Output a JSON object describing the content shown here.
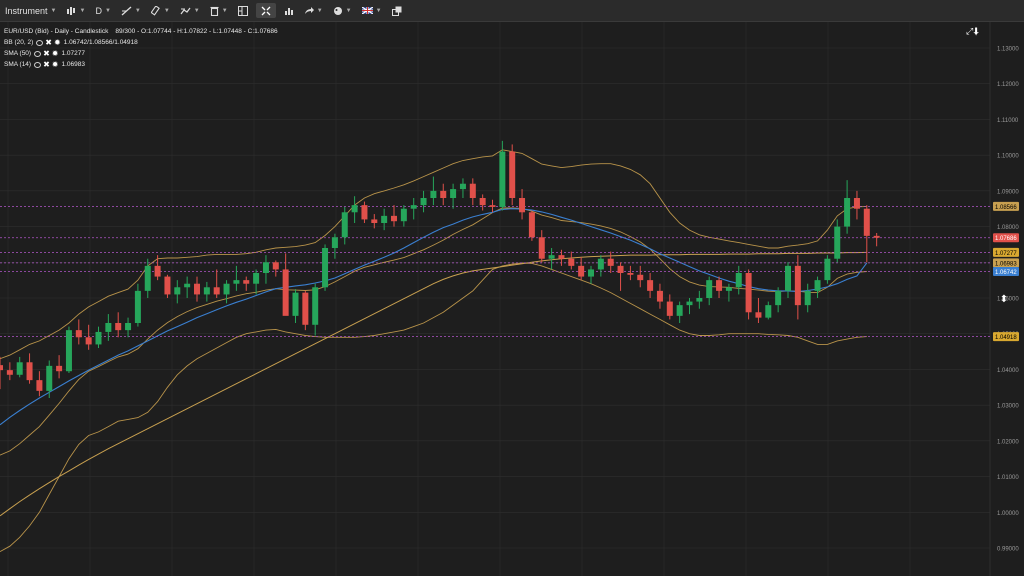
{
  "toolbar": {
    "instrument_label": "Instrument",
    "timeframe_label": "D",
    "icons": [
      "chart-type-icon",
      "draw-line-icon",
      "ruler-icon",
      "indicators-icon",
      "delete-icon",
      "layout-icon",
      "fit-icon",
      "bar-chart-icon",
      "share-icon",
      "theme-icon",
      "language-flag-icon",
      "popout-icon"
    ]
  },
  "legend": {
    "title": "EUR/USD (Bid) - Daily - Candlestick",
    "ohlc": "89/300 - O:1.07744 - H:1.07822 - L:1.07448 - C:1.07686",
    "indicators": [
      {
        "name": "BB (20, 2)",
        "value": "1.06742/1.08566/1.04918"
      },
      {
        "name": "SMA (50)",
        "value": "1.07277"
      },
      {
        "name": "SMA (14)",
        "value": "1.06983"
      }
    ]
  },
  "colors": {
    "bg": "#1e1e1e",
    "grid": "#2e2e2e",
    "up": "#26a65b",
    "down": "#e0504a",
    "bb": "#b8934a",
    "sma50": "#c8a050",
    "sma14": "#3a7fd0",
    "level_line": "#b056c8"
  },
  "chart_data": {
    "type": "candlestick",
    "instrument": "EUR/USD (Bid)",
    "timeframe": "Daily",
    "ylim": [
      0.99,
      1.135
    ],
    "y_ticks": [
      "1.13000",
      "1.12000",
      "1.11000",
      "1.10000",
      "1.09000",
      "1.08000",
      "1.07000",
      "1.06000",
      "1.05000",
      "1.04000",
      "1.03000",
      "1.02000",
      "1.01000",
      "1.00000",
      "0.99000"
    ],
    "candles": [
      [
        1.0412,
        1.0435,
        1.0345,
        1.0398
      ],
      [
        1.0398,
        1.042,
        1.037,
        1.0385
      ],
      [
        1.0385,
        1.0435,
        1.0378,
        1.042
      ],
      [
        1.042,
        1.0445,
        1.036,
        1.037
      ],
      [
        1.037,
        1.0395,
        1.0325,
        1.034
      ],
      [
        1.034,
        1.0425,
        1.032,
        1.041
      ],
      [
        1.041,
        1.044,
        1.0375,
        1.0395
      ],
      [
        1.0395,
        1.052,
        1.039,
        1.051
      ],
      [
        1.051,
        1.054,
        1.047,
        1.049
      ],
      [
        1.049,
        1.0525,
        1.0455,
        1.047
      ],
      [
        1.047,
        1.052,
        1.046,
        1.0505
      ],
      [
        1.0505,
        1.0555,
        1.048,
        1.053
      ],
      [
        1.053,
        1.056,
        1.049,
        1.051
      ],
      [
        1.051,
        1.0545,
        1.049,
        1.053
      ],
      [
        1.053,
        1.064,
        1.052,
        1.062
      ],
      [
        1.062,
        1.071,
        1.06,
        1.069
      ],
      [
        1.069,
        1.072,
        1.065,
        1.066
      ],
      [
        1.066,
        1.0665,
        1.06,
        1.061
      ],
      [
        1.061,
        1.065,
        1.0585,
        1.063
      ],
      [
        1.063,
        1.066,
        1.06,
        1.064
      ],
      [
        1.064,
        1.066,
        1.059,
        1.061
      ],
      [
        1.061,
        1.0645,
        1.059,
        1.063
      ],
      [
        1.063,
        1.068,
        1.06,
        1.061
      ],
      [
        1.061,
        1.065,
        1.0585,
        1.064
      ],
      [
        1.064,
        1.069,
        1.062,
        1.065
      ],
      [
        1.065,
        1.066,
        1.062,
        1.064
      ],
      [
        1.064,
        1.068,
        1.061,
        1.067
      ],
      [
        1.067,
        1.072,
        1.064,
        1.07
      ],
      [
        1.07,
        1.0705,
        1.066,
        1.068
      ],
      [
        1.068,
        1.0725,
        1.06,
        1.055
      ],
      [
        1.055,
        1.0625,
        1.053,
        1.0615
      ],
      [
        1.0615,
        1.062,
        1.051,
        1.0525
      ],
      [
        1.0525,
        1.064,
        1.0495,
        1.063
      ],
      [
        1.063,
        1.075,
        1.062,
        1.074
      ],
      [
        1.074,
        1.078,
        1.071,
        1.077
      ],
      [
        1.077,
        1.0855,
        1.075,
        1.084
      ],
      [
        1.084,
        1.0885,
        1.081,
        1.086
      ],
      [
        1.086,
        1.087,
        1.081,
        1.082
      ],
      [
        1.082,
        1.0835,
        1.0795,
        1.081
      ],
      [
        1.081,
        1.085,
        1.079,
        1.083
      ],
      [
        1.083,
        1.086,
        1.08,
        1.0815
      ],
      [
        1.0815,
        1.086,
        1.08,
        1.085
      ],
      [
        1.085,
        1.088,
        1.082,
        1.086
      ],
      [
        1.086,
        1.09,
        1.084,
        1.088
      ],
      [
        1.088,
        1.094,
        1.086,
        1.09
      ],
      [
        1.09,
        1.092,
        1.086,
        1.088
      ],
      [
        1.088,
        1.092,
        1.085,
        1.0905
      ],
      [
        1.0905,
        1.0935,
        1.088,
        1.092
      ],
      [
        1.092,
        1.0935,
        1.086,
        1.088
      ],
      [
        1.088,
        1.089,
        1.0845,
        1.086
      ],
      [
        1.086,
        1.0875,
        1.084,
        1.0855
      ],
      [
        1.0855,
        1.104,
        1.0845,
        1.101
      ],
      [
        1.101,
        1.103,
        1.086,
        1.088
      ],
      [
        1.088,
        1.0905,
        1.082,
        1.084
      ],
      [
        1.084,
        1.0845,
        1.076,
        1.077
      ],
      [
        1.077,
        1.079,
        1.07,
        1.071
      ],
      [
        1.071,
        1.074,
        1.068,
        1.072
      ],
      [
        1.072,
        1.0735,
        1.069,
        1.071
      ],
      [
        1.071,
        1.073,
        1.068,
        1.069
      ],
      [
        1.069,
        1.0715,
        1.065,
        1.066
      ],
      [
        1.066,
        1.069,
        1.064,
        1.068
      ],
      [
        1.068,
        1.072,
        1.066,
        1.071
      ],
      [
        1.071,
        1.073,
        1.067,
        1.069
      ],
      [
        1.069,
        1.07,
        1.062,
        1.067
      ],
      [
        1.067,
        1.069,
        1.065,
        1.0665
      ],
      [
        1.0665,
        1.069,
        1.063,
        1.065
      ],
      [
        1.065,
        1.067,
        1.06,
        1.062
      ],
      [
        1.062,
        1.064,
        1.057,
        1.059
      ],
      [
        1.059,
        1.061,
        1.054,
        1.055
      ],
      [
        1.055,
        1.059,
        1.053,
        1.058
      ],
      [
        1.058,
        1.06,
        1.0555,
        1.059
      ],
      [
        1.059,
        1.062,
        1.057,
        1.06
      ],
      [
        1.06,
        1.066,
        1.058,
        1.065
      ],
      [
        1.065,
        1.066,
        1.06,
        1.062
      ],
      [
        1.062,
        1.064,
        1.059,
        1.063
      ],
      [
        1.063,
        1.069,
        1.061,
        1.067
      ],
      [
        1.067,
        1.068,
        1.054,
        1.056
      ],
      [
        1.056,
        1.06,
        1.053,
        1.0545
      ],
      [
        1.0545,
        1.059,
        1.054,
        1.058
      ],
      [
        1.058,
        1.063,
        1.056,
        1.062
      ],
      [
        1.062,
        1.07,
        1.06,
        1.069
      ],
      [
        1.069,
        1.072,
        1.054,
        1.058
      ],
      [
        1.058,
        1.064,
        1.056,
        1.062
      ],
      [
        1.062,
        1.066,
        1.06,
        1.065
      ],
      [
        1.065,
        1.072,
        1.064,
        1.071
      ],
      [
        1.071,
        1.082,
        1.07,
        1.08
      ],
      [
        1.08,
        1.093,
        1.078,
        1.088
      ],
      [
        1.088,
        1.09,
        1.082,
        1.085
      ],
      [
        1.085,
        1.086,
        1.07,
        1.0774
      ],
      [
        1.0774,
        1.0782,
        1.07448,
        1.07686
      ]
    ],
    "sma14": [
      1.0245,
      1.0266,
      1.0285,
      1.0303,
      1.032,
      1.0336,
      1.0352,
      1.0368,
      1.0383,
      1.0398,
      1.0412,
      1.0426,
      1.044,
      1.0452,
      1.0466,
      1.048,
      1.0494,
      1.0508,
      1.052,
      1.0532,
      1.0545,
      1.0556,
      1.0567,
      1.0578,
      1.0588,
      1.0597,
      1.0607,
      1.0617,
      1.0626,
      1.063,
      1.0634,
      1.0637,
      1.0642,
      1.0648,
      1.0656,
      1.0668,
      1.068,
      1.0692,
      1.0703,
      1.0714,
      1.0726,
      1.074,
      1.0755,
      1.077,
      1.0784,
      1.0797,
      1.0807,
      1.0818,
      1.0827,
      1.0834,
      1.084,
      1.0848,
      1.085,
      1.0849,
      1.0846,
      1.0841,
      1.0834,
      1.0826,
      1.0818,
      1.0809,
      1.08,
      1.0791,
      1.0782,
      1.0772,
      1.0762,
      1.075,
      1.0738,
      1.0724,
      1.0712,
      1.07,
      1.0688,
      1.0676,
      1.0666,
      1.0656,
      1.0647,
      1.064,
      1.0632,
      1.0626,
      1.0622,
      1.062,
      1.062,
      1.0618,
      1.0621,
      1.0625,
      1.0631,
      1.064,
      1.0652,
      1.0662,
      1.06983
    ],
    "sma50": [
      0.999,
      1.001,
      1.003,
      1.0048,
      1.0066,
      1.0083,
      1.01,
      1.0116,
      1.0132,
      1.0148,
      1.0163,
      1.0178,
      1.0192,
      1.0206,
      1.022,
      1.0234,
      1.0248,
      1.0262,
      1.0276,
      1.029,
      1.0304,
      1.0318,
      1.0332,
      1.0346,
      1.036,
      1.0374,
      1.0388,
      1.0402,
      1.0416,
      1.043,
      1.0444,
      1.0458,
      1.0472,
      1.0486,
      1.05,
      1.0514,
      1.0528,
      1.0542,
      1.0556,
      1.057,
      1.0584,
      1.0598,
      1.0612,
      1.0626,
      1.064,
      1.0652,
      1.0662,
      1.067,
      1.0676,
      1.068,
      1.0684,
      1.0688,
      1.0692,
      1.0696,
      1.07,
      1.0704,
      1.0707,
      1.071,
      1.0712,
      1.0714,
      1.0716,
      1.0717,
      1.0718,
      1.0719,
      1.072,
      1.072,
      1.072,
      1.0721,
      1.0721,
      1.0721,
      1.0722,
      1.0722,
      1.0722,
      1.0722,
      1.0723,
      1.0723,
      1.0723,
      1.0724,
      1.0724,
      1.0724,
      1.0725,
      1.0725,
      1.0725,
      1.0726,
      1.0726,
      1.0726,
      1.0727,
      1.0727,
      1.07277
    ],
    "bb_upper": [
      1.043,
      1.044,
      1.0455,
      1.047,
      1.048,
      1.0495,
      1.051,
      1.053,
      1.0555,
      1.0575,
      1.059,
      1.0605,
      1.0615,
      1.0625,
      1.065,
      1.069,
      1.071,
      1.0712,
      1.0712,
      1.0714,
      1.0716,
      1.072,
      1.0722,
      1.0722,
      1.0722,
      1.0724,
      1.0728,
      1.0735,
      1.074,
      1.0742,
      1.0744,
      1.0748,
      1.0755,
      1.0775,
      1.08,
      1.083,
      1.086,
      1.088,
      1.0892,
      1.09,
      1.0908,
      1.0917,
      1.0928,
      1.094,
      1.0952,
      1.0964,
      1.0976,
      1.0985,
      1.099,
      1.0995,
      1.0998,
      1.1015,
      1.101,
      1.1005,
      1.099,
      1.0975,
      1.097,
      1.0965,
      1.0968,
      1.0972,
      1.0975,
      1.0976,
      1.0976,
      1.097,
      1.096,
      1.0945,
      1.092,
      1.088,
      1.084,
      1.081,
      1.079,
      1.0777,
      1.077,
      1.0765,
      1.076,
      1.0755,
      1.075,
      1.0745,
      1.074,
      1.074,
      1.0745,
      1.0748,
      1.0752,
      1.076,
      1.079,
      1.083,
      1.085,
      1.0855,
      1.08566
    ],
    "bb_lower": [
      0.989,
      0.9905,
      0.993,
      0.9962,
      1.0,
      1.005,
      1.01,
      1.015,
      1.019,
      1.0215,
      1.0225,
      1.024,
      1.0255,
      1.026,
      1.0265,
      1.028,
      1.031,
      1.035,
      1.0385,
      1.041,
      1.043,
      1.0445,
      1.046,
      1.0475,
      1.049,
      1.05,
      1.0505,
      1.051,
      1.0512,
      1.0505,
      1.05,
      1.0495,
      1.0492,
      1.049,
      1.049,
      1.049,
      1.049,
      1.0492,
      1.0495,
      1.05,
      1.0505,
      1.051,
      1.052,
      1.053,
      1.0545,
      1.056,
      1.058,
      1.06,
      1.062,
      1.065,
      1.068,
      1.069,
      1.0695,
      1.0698,
      1.0697,
      1.069,
      1.068,
      1.067,
      1.066,
      1.065,
      1.064,
      1.0628,
      1.0615,
      1.06,
      1.0585,
      1.057,
      1.0555,
      1.054,
      1.0525,
      1.051,
      1.05,
      1.0495,
      1.0495,
      1.0497,
      1.05,
      1.05,
      1.05,
      1.05,
      1.0498,
      1.0497,
      1.0495,
      1.049,
      1.048,
      1.047,
      1.047,
      1.048,
      1.0485,
      1.049,
      1.04918
    ],
    "bb_middle": [
      1.016,
      1.0172,
      1.0192,
      1.0216,
      1.024,
      1.0272,
      1.0305,
      1.034,
      1.0372,
      1.0395,
      1.0408,
      1.0422,
      1.0435,
      1.0443,
      1.0458,
      1.0485,
      1.051,
      1.0531,
      1.0548,
      1.0562,
      1.0573,
      1.0582,
      1.0591,
      1.0598,
      1.0606,
      1.0612,
      1.0616,
      1.0622,
      1.0626,
      1.0623,
      1.0622,
      1.0621,
      1.0623,
      1.0632,
      1.0645,
      1.066,
      1.0675,
      1.0686,
      1.0693,
      1.07,
      1.0706,
      1.0713,
      1.0724,
      1.0735,
      1.0748,
      1.0762,
      1.0778,
      1.0792,
      1.0805,
      1.0822,
      1.0839,
      1.0852,
      1.0852,
      1.0851,
      1.0843,
      1.0832,
      1.0825,
      1.0817,
      1.0814,
      1.0811,
      1.0807,
      1.0802,
      1.0795,
      1.0785,
      1.0772,
      1.0757,
      1.0737,
      1.071,
      1.0682,
      1.066,
      1.0645,
      1.0636,
      1.0632,
      1.0631,
      1.063,
      1.0627,
      1.0625,
      1.0622,
      1.0619,
      1.0618,
      1.062,
      1.0619,
      1.0616,
      1.0615,
      1.063,
      1.0655,
      1.0667,
      1.0672,
      1.06742
    ],
    "horizontal_levels": [
      1.08566,
      1.07686,
      1.07277,
      1.06983,
      1.06742,
      1.04918
    ],
    "price_labels": [
      {
        "text": "1.08566",
        "value": 1.08566,
        "color": "#c8a050",
        "text_color": "#000"
      },
      {
        "text": "1.07686",
        "value": 1.07686,
        "color": "#e0504a",
        "text_color": "#fff"
      },
      {
        "text": "1.07277",
        "value": 1.07277,
        "color": "#d8a830",
        "text_color": "#000"
      },
      {
        "text": "1.06983",
        "value": 1.06983,
        "color": "#c8a050",
        "text_color": "#000"
      },
      {
        "text": "1.06742",
        "value": 1.06742,
        "color": "#3a7fd0",
        "text_color": "#fff"
      },
      {
        "text": "1.04918",
        "value": 1.04918,
        "color": "#d8a830",
        "text_color": "#000"
      }
    ]
  }
}
